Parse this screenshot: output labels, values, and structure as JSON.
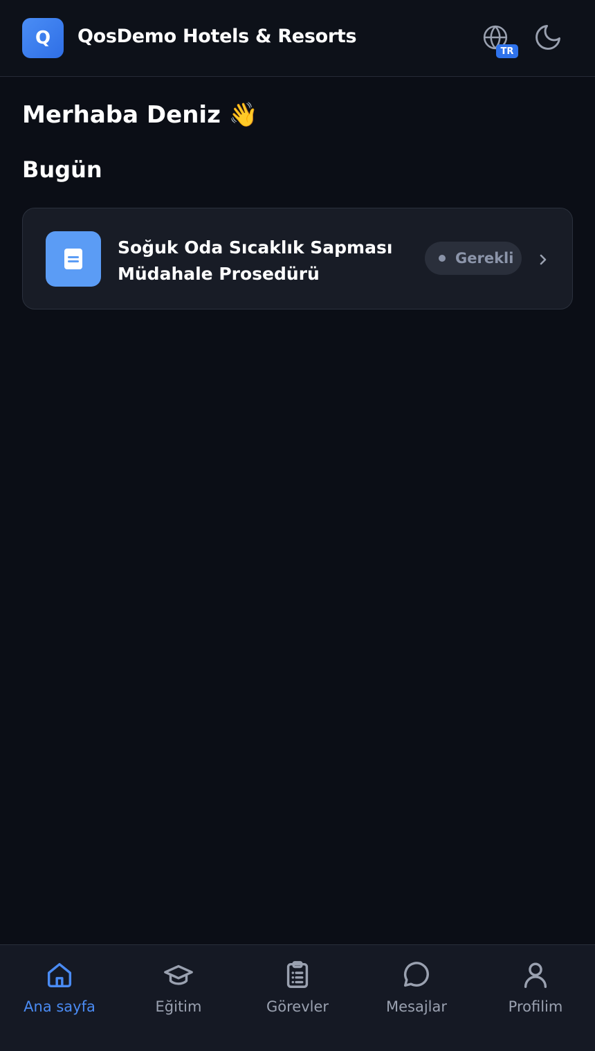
{
  "header": {
    "logo_letter": "Q",
    "app_title": "QosDemo Hotels & Resorts",
    "language_badge": "TR"
  },
  "greeting": "Merhaba Deniz 👋",
  "today_section": {
    "title": "Bugün",
    "items": [
      {
        "title": "Soğuk Oda Sıcaklık Sapması Müdahale Prosedürü",
        "status": "Gerekli",
        "icon": "document-icon"
      }
    ]
  },
  "bottom_nav": {
    "items": [
      {
        "label": "Ana sayfa",
        "icon": "home-icon",
        "active": true
      },
      {
        "label": "Eğitim",
        "icon": "graduation-cap-icon",
        "active": false
      },
      {
        "label": "Görevler",
        "icon": "clipboard-icon",
        "active": false
      },
      {
        "label": "Mesajlar",
        "icon": "chat-bubble-icon",
        "active": false
      },
      {
        "label": "Profilim",
        "icon": "user-icon",
        "active": false
      }
    ]
  },
  "colors": {
    "background": "#0b0e16",
    "accent": "#4a8bf3",
    "card": "#181c26",
    "muted_text": "#9aa1b0"
  }
}
